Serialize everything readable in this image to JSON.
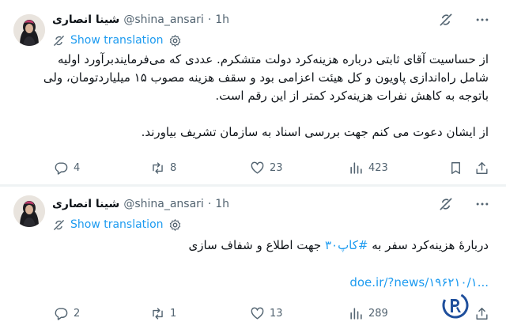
{
  "tweets": [
    {
      "author_name": "شینا انصاری",
      "handle": "@shina_ansari",
      "separator": "·",
      "time": "1h",
      "translate_label": "Show translation",
      "body_lines": [
        "از حساسیت آقای ثابتی درباره هزینه‌کرد دولت متشکرم. عددی که می‌فرمایندبرآورد اولیه",
        "شامل راه‌اندازی پاویون و کل هیئت اعزامی بود و سقف هزینه مصوب ۱۵ میلیاردتومان، ولی",
        "باتوجه به کاهش نفرات هزینه‌کرد کمتر از این رقم است.",
        "",
        "از ایشان دعوت می کنم جهت بررسی اسناد به سازمان تشریف بیاورند."
      ],
      "stats": {
        "replies": "4",
        "retweets": "8",
        "likes": "23",
        "views": "423"
      }
    },
    {
      "author_name": "شینا انصاری",
      "handle": "@shina_ansari",
      "separator": "·",
      "time": "1h",
      "translate_label": "Show translation",
      "body_before": "دربارهٔ هزینه‌کرد سفر به ",
      "hashtag": "#کاپ۳۰",
      "body_after": " جهت اطلاع و شفاف سازی",
      "link": "doe.ir/?news/۱۹۶۲۱۰/۱...",
      "stats": {
        "replies": "2",
        "retweets": "1",
        "likes": "13",
        "views": "289"
      }
    }
  ],
  "icons": {
    "grok": "grok-icon",
    "more": "more-icon",
    "translate": "gear-icon",
    "reply": "reply-icon",
    "retweet": "retweet-icon",
    "like": "heart-icon",
    "views": "views-icon",
    "bookmark": "bookmark-icon",
    "share": "share-icon",
    "watermark": "logo-icon"
  },
  "colors": {
    "link": "#1d9bf0",
    "muted": "#536471",
    "text": "#0f1419",
    "divider": "#eff3f4"
  }
}
